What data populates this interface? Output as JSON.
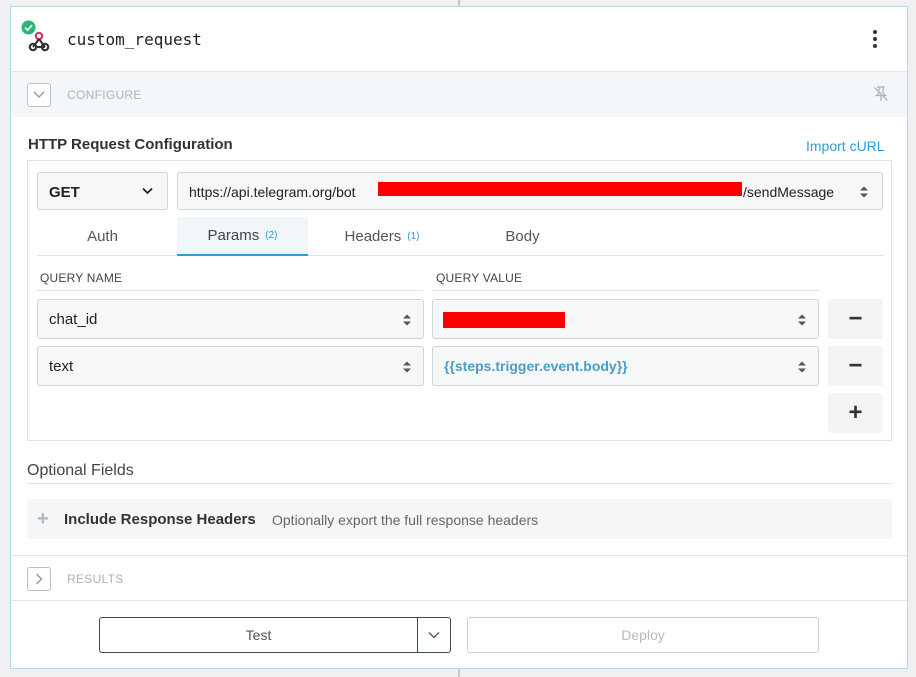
{
  "step": {
    "icon": "webhook-icon",
    "status_icon": "check-circle-icon",
    "title": "custom_request",
    "menu_icon": "kebab-menu-icon"
  },
  "configure": {
    "label": "CONFIGURE",
    "toggle_icon": "chevron-down-icon",
    "pin_icon": "unpin-icon"
  },
  "http": {
    "title": "HTTP Request Configuration",
    "import_label": "Import cURL",
    "method": "GET",
    "url_prefix": "https://api.telegram.org/bot",
    "url_suffix": "/sendMessage",
    "tabs": [
      {
        "label": "Auth",
        "count": ""
      },
      {
        "label": "Params",
        "count": "(2)"
      },
      {
        "label": "Headers",
        "count": "(1)"
      },
      {
        "label": "Body",
        "count": ""
      }
    ],
    "active_tab": "Params",
    "columns": {
      "name": "QUERY NAME",
      "value": "QUERY VALUE"
    },
    "params": [
      {
        "name": "chat_id",
        "value": ""
      },
      {
        "name": "text",
        "value": "{{steps.trigger.event.body}}"
      }
    ],
    "remove_label": "−",
    "add_label": "+"
  },
  "optional": {
    "title": "Optional Fields",
    "items": [
      {
        "name": "Include Response Headers",
        "description": "Optionally export the full response headers"
      }
    ]
  },
  "results": {
    "label": "RESULTS",
    "toggle_icon": "chevron-right-icon"
  },
  "footer": {
    "test_label": "Test",
    "deploy_label": "Deploy"
  },
  "colors": {
    "accent": "#2a9fd8",
    "success": "#2bb673",
    "redaction": "#ff0000",
    "template": "#4a9ec7"
  }
}
